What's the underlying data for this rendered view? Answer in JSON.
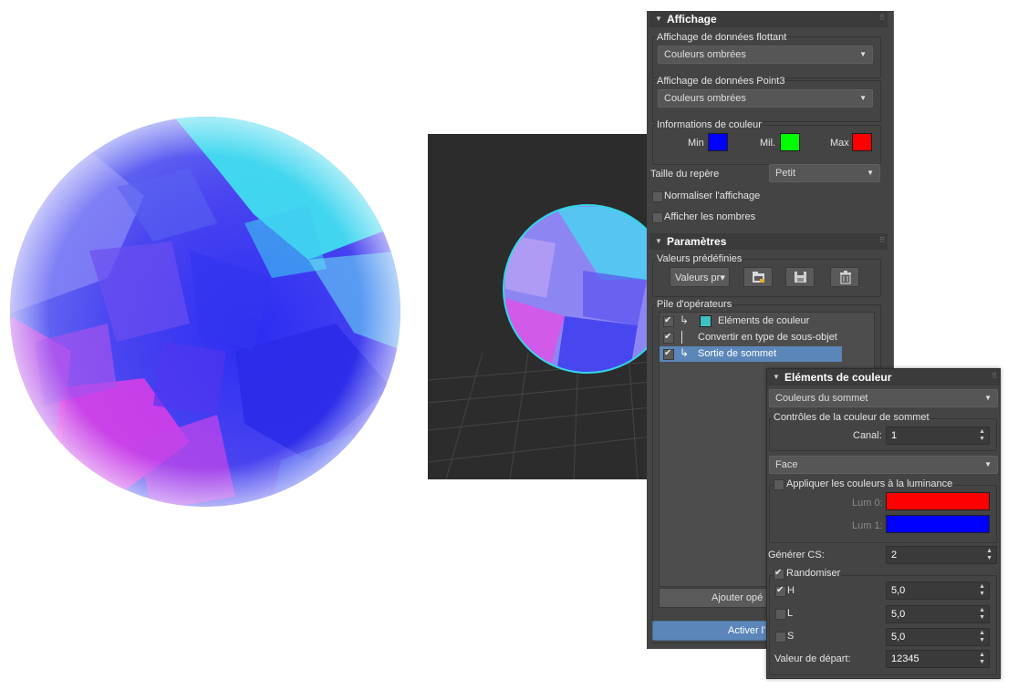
{
  "affichage": {
    "title": "Affichage",
    "float_label": "Affichage de données flottant",
    "float_value": "Couleurs ombrées",
    "point3_label": "Affichage de données Point3",
    "point3_value": "Couleurs ombrées",
    "color_info_label": "Informations de couleur",
    "min_label": "Min",
    "mid_label": "Mil.",
    "max_label": "Max",
    "min_color": "#0000ff",
    "mid_color": "#00ff00",
    "max_color": "#ff0000",
    "gizmo_size_label": "Taille du repère",
    "gizmo_size_value": "Petit",
    "normalize_label": "Normaliser l'affichage",
    "show_numbers_label": "Afficher les nombres"
  },
  "parametres": {
    "title": "Paramètres",
    "presets_label": "Valeurs prédéfinies",
    "presets_button": "Valeurs pr▾",
    "stack_label": "Pile d'opérateurs",
    "operators": [
      {
        "label": "Eléments de couleur",
        "checked": true
      },
      {
        "label": "Convertir en type de sous-objet",
        "checked": true
      },
      {
        "label": "Sortie de sommet",
        "checked": true
      }
    ],
    "add_button": "Ajouter opé",
    "activate_button": "Activer l'"
  },
  "elements": {
    "title": "Eléments de couleur",
    "source_value": "Couleurs du sommet",
    "vertex_ctrl_label": "Contrôles de la couleur de sommet",
    "channel_label": "Canal:",
    "channel_value": "1",
    "face_value": "Face",
    "apply_lum_label": "Appliquer les couleurs à la luminance",
    "lum0_label": "Lum 0:",
    "lum1_label": "Lum 1:",
    "lum0_color": "#ff0000",
    "lum1_color": "#0000ff",
    "gen_cs_label": "Générer CS:",
    "gen_cs_value": "2",
    "randomize_label": "Randomiser",
    "h_label": "H",
    "h_value": "5,0",
    "l_label": "L",
    "l_value": "5,0",
    "s_label": "S",
    "s_value": "5,0",
    "seed_label": "Valeur de départ:",
    "seed_value": "12345"
  }
}
